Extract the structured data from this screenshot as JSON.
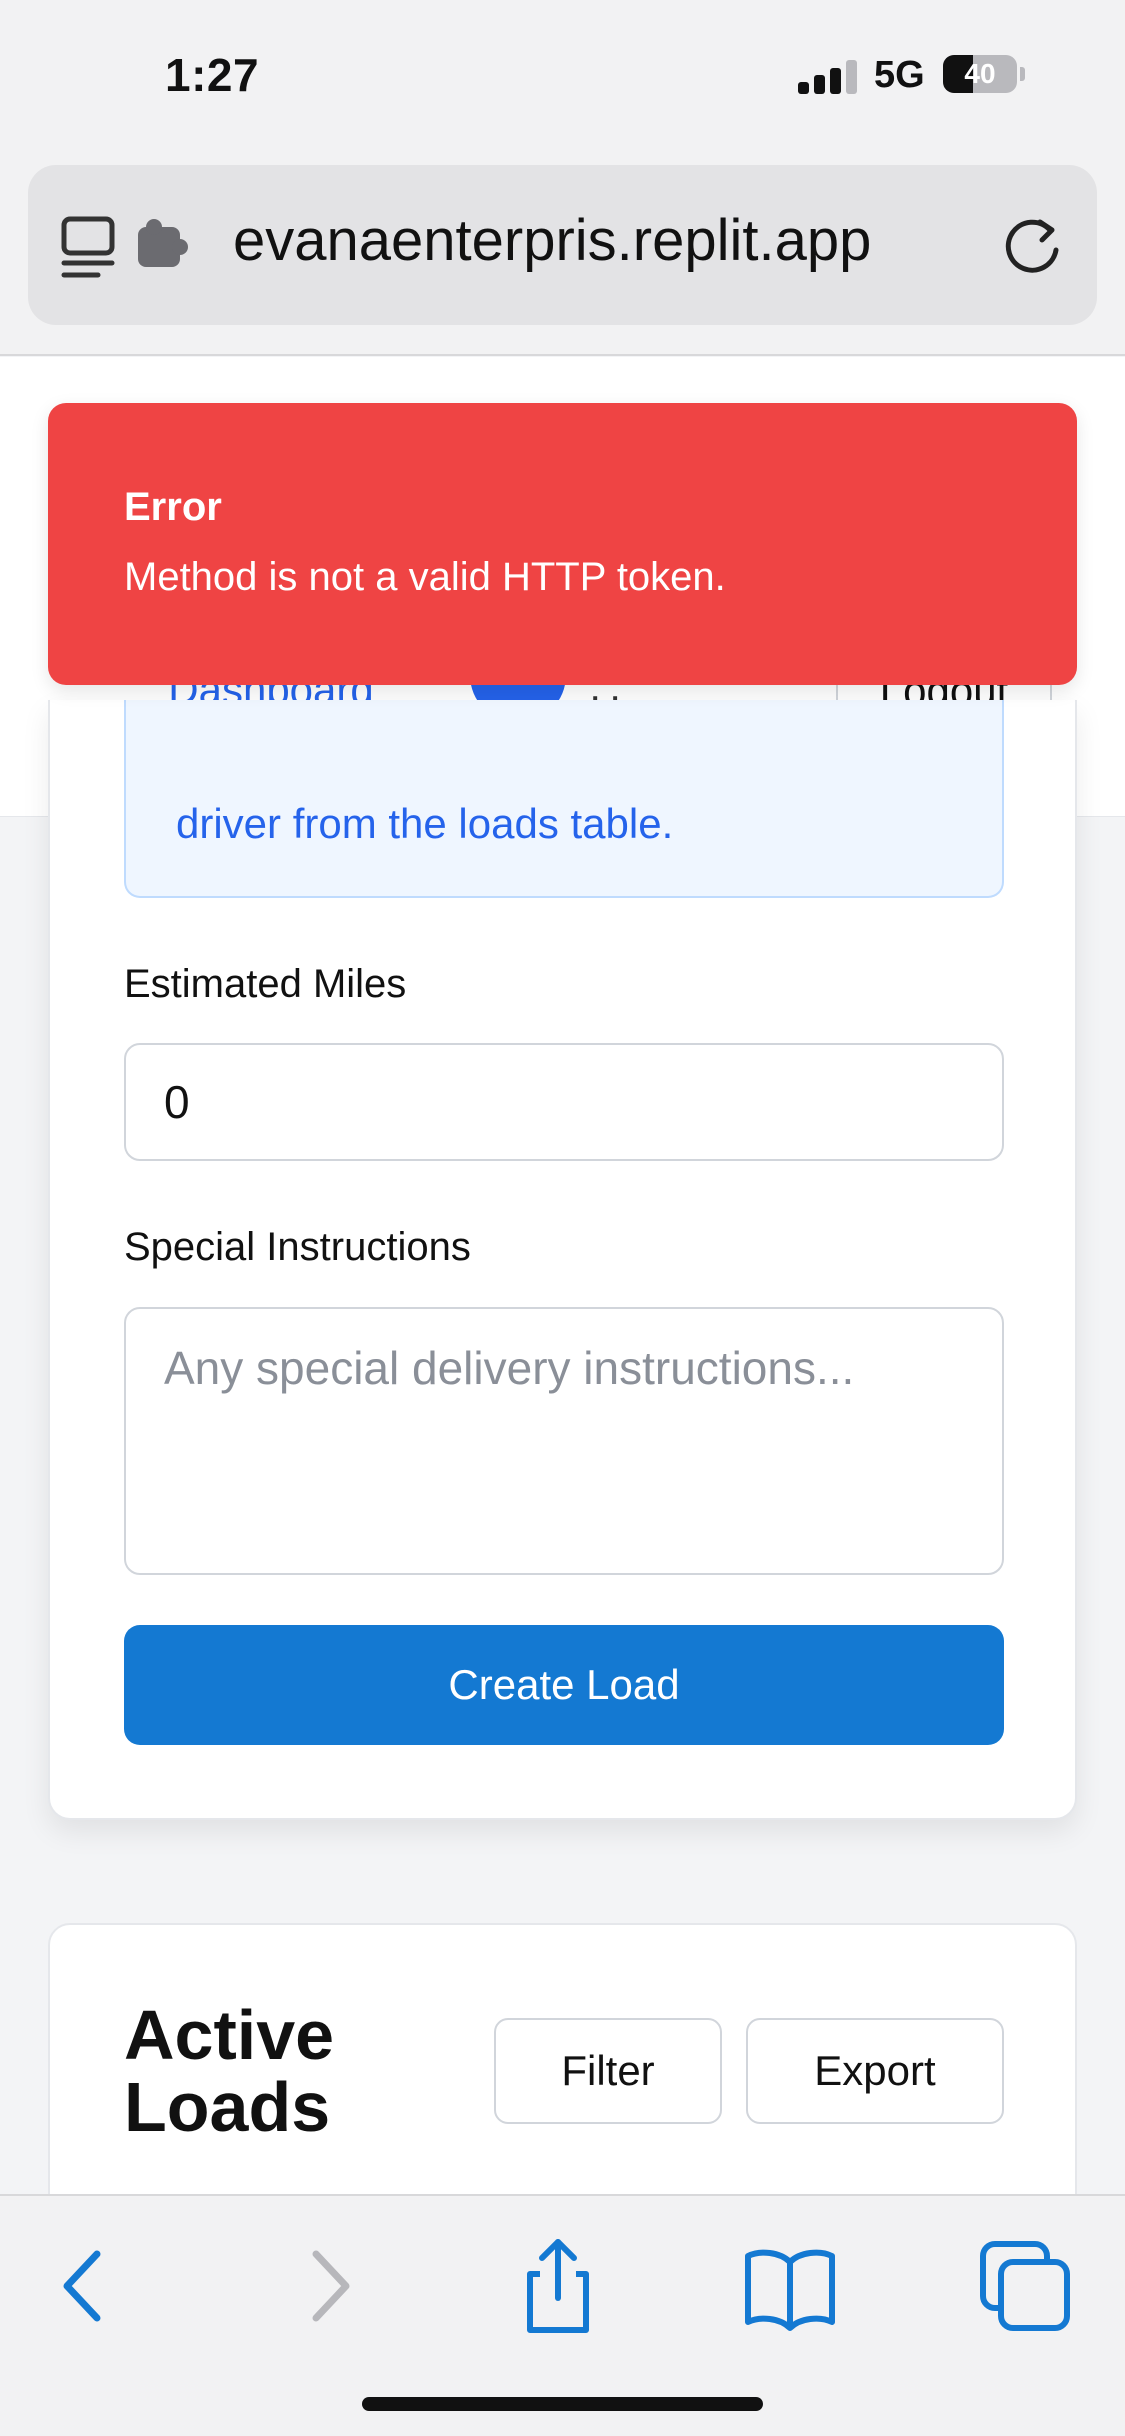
{
  "status_bar": {
    "time": "1:27",
    "network": "5G",
    "battery": "40",
    "battery_level": 0.4
  },
  "browser": {
    "url": "evanaenterpris.replit.app",
    "icons": [
      "tab-overview-icon",
      "extension-icon",
      "reload-icon"
    ]
  },
  "header": {
    "dashboard_tab": "Dashboard",
    "help_icon_glyph": "?",
    "user_label": "User",
    "logout_label": "Logout"
  },
  "toast": {
    "title": "Error",
    "message": "Method is not a valid HTTP token."
  },
  "form": {
    "info_text": "driver from the loads table.",
    "estimated_miles": {
      "label": "Estimated Miles",
      "value": "0"
    },
    "special_instructions": {
      "label": "Special Instructions",
      "placeholder": "Any special delivery instructions..."
    },
    "submit_label": "Create Load"
  },
  "active_loads": {
    "title_line1": "Active",
    "title_line2": "Loads",
    "filter_label": "Filter",
    "export_label": "Export"
  },
  "toolbar": {
    "items": [
      "back-icon",
      "forward-icon",
      "share-icon",
      "bookmarks-icon",
      "tabs-icon"
    ]
  },
  "colors": {
    "accent": "#2563eb",
    "error": "#ef4444",
    "button": "#1479d2"
  }
}
